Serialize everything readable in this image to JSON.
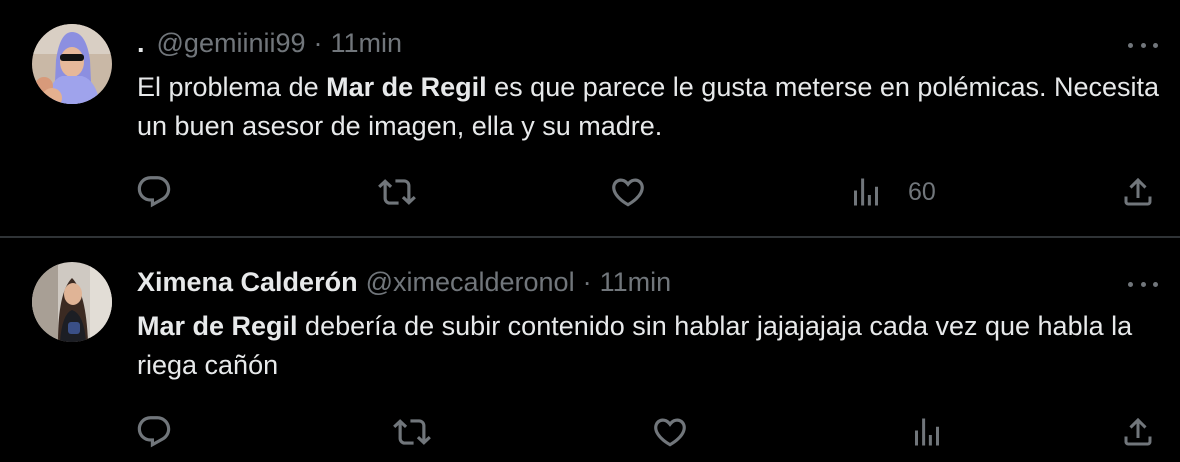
{
  "colors": {
    "background": "#000000",
    "text_primary": "#e7e9ea",
    "text_secondary": "#71767b",
    "divider": "#2f3336"
  },
  "tweets": [
    {
      "display_name": ".",
      "handle": "@gemiinii99",
      "separator": "·",
      "time": "11min",
      "text_parts": [
        {
          "text": "El problema de ",
          "bold": false
        },
        {
          "text": "Mar de Regil",
          "bold": true
        },
        {
          "text": " es que parece le gusta meterse en polémicas. Necesita un buen asesor de imagen, ella y su madre.",
          "bold": false
        }
      ],
      "views": "60",
      "icons": [
        "reply-icon",
        "retweet-icon",
        "like-icon",
        "views-icon",
        "share-icon",
        "more-icon"
      ]
    },
    {
      "display_name": "Ximena Calderón",
      "handle": "@ximecalderonol",
      "separator": "·",
      "time": "11min",
      "text_parts": [
        {
          "text": "Mar de Regil",
          "bold": true
        },
        {
          "text": " debería de subir contenido sin hablar jajajajaja cada vez que habla la riega cañón",
          "bold": false
        }
      ],
      "views": "",
      "icons": [
        "reply-icon",
        "retweet-icon",
        "like-icon",
        "views-icon",
        "share-icon",
        "more-icon"
      ]
    }
  ]
}
